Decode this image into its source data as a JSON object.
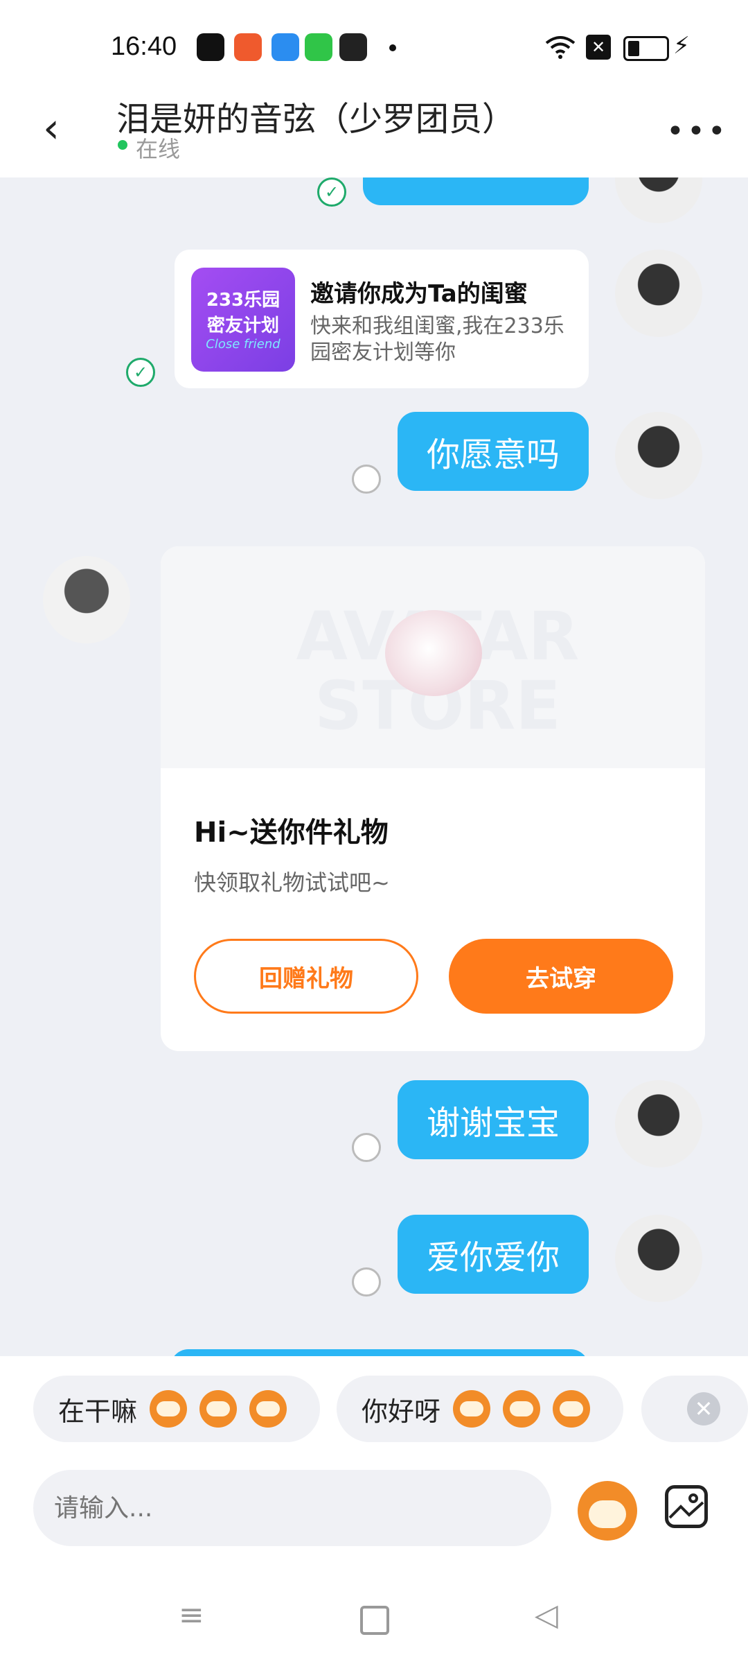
{
  "status_bar": {
    "time": "16:40"
  },
  "header": {
    "title": "泪是妍的音弦（少罗团员）",
    "online_label": "在线"
  },
  "messages": {
    "invite_card": {
      "image_text_line1": "233乐园",
      "image_text_line2": "密友计划",
      "image_text_line3": "Close friend",
      "title": "邀请你成为Ta的闺蜜",
      "desc": "快来和我组闺蜜,我在233乐园密友计划等你"
    },
    "bubble_1": "你愿意吗",
    "gift_card": {
      "watermark": "AVATAR STORE",
      "title": "Hi~送你件礼物",
      "subtitle": "快领取礼物试试吧~",
      "return_gift_label": "回赠礼物",
      "try_on_label": "去试穿"
    },
    "bubble_2": "谢谢宝宝",
    "bubble_3": "爱你爱你"
  },
  "quick_replies": [
    {
      "text": "在干嘛"
    },
    {
      "text": "你好呀"
    }
  ],
  "composer": {
    "placeholder": "请输入..."
  },
  "colors": {
    "bubble": "#2bb6f5",
    "accent_orange": "#ff7a1a",
    "online_green": "#22c55e"
  }
}
